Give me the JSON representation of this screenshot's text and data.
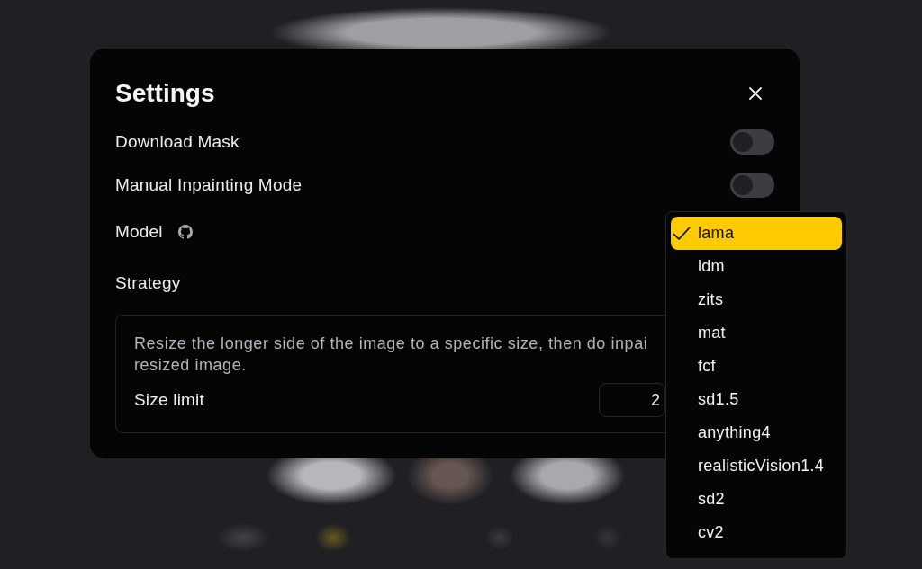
{
  "dialog": {
    "title": "Settings",
    "rows": [
      {
        "kind": "toggle",
        "label": "Download Mask",
        "on": false
      },
      {
        "kind": "toggle",
        "label": "Manual Inpainting Mode",
        "on": false
      },
      {
        "kind": "link",
        "label": "Model"
      },
      {
        "kind": "plain",
        "label": "Strategy"
      }
    ],
    "strategy_panel": {
      "description_lines": [
        "Resize the longer side of the image to a specific size, then do inpai",
        "resized image."
      ],
      "size_limit": {
        "label": "Size limit",
        "value": "2"
      }
    }
  },
  "model_menu": {
    "options": [
      {
        "label": "lama",
        "selected": true
      },
      {
        "label": "ldm",
        "selected": false
      },
      {
        "label": "zits",
        "selected": false
      },
      {
        "label": "mat",
        "selected": false
      },
      {
        "label": "fcf",
        "selected": false
      },
      {
        "label": "sd1.5",
        "selected": false
      },
      {
        "label": "anything4",
        "selected": false
      },
      {
        "label": "realisticVision1.4",
        "selected": false
      },
      {
        "label": "sd2",
        "selected": false
      },
      {
        "label": "cv2",
        "selected": false
      }
    ]
  }
}
